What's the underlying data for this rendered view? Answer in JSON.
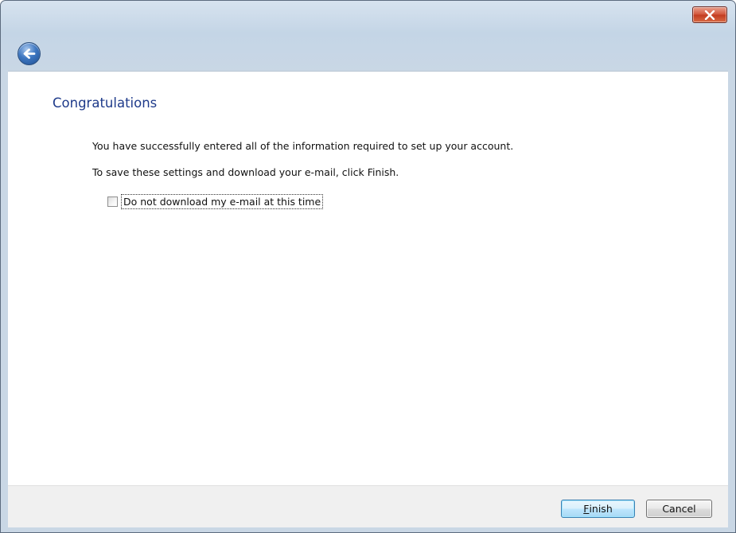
{
  "window": {
    "close_icon": "close-icon",
    "back_icon": "back-arrow-icon"
  },
  "content": {
    "heading": "Congratulations",
    "message_line_1": "You have successfully entered all of the information required to set up your account.",
    "message_line_2": "To save these settings and download your e-mail, click Finish.",
    "checkbox_label": "Do not download my e-mail at this time",
    "checkbox_checked": false
  },
  "footer": {
    "finish_label_accel": "F",
    "finish_label_rest": "inish",
    "cancel_label": "Cancel"
  },
  "colors": {
    "heading": "#1e3a8a",
    "close_button": "#c94a2f",
    "finish_border": "#3c7fb1"
  }
}
